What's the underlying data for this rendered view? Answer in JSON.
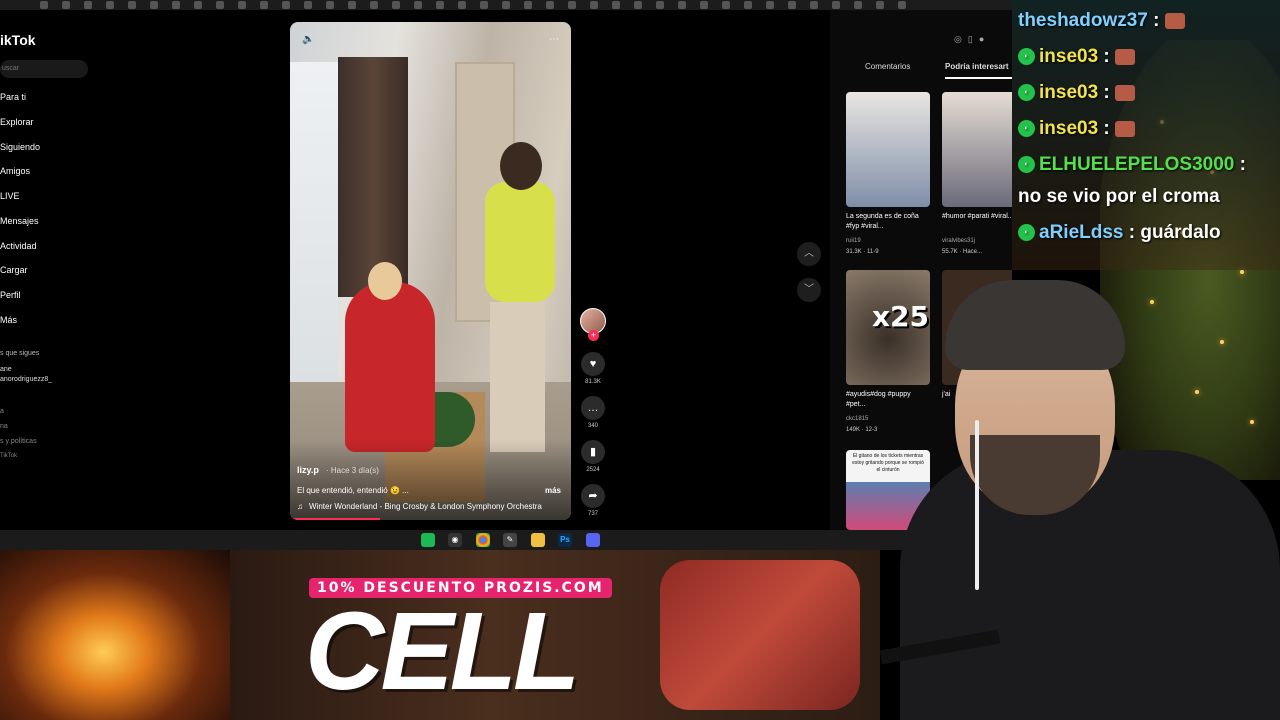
{
  "tiktok": {
    "logo": "ikTok",
    "search_placeholder": "uscar",
    "nav": [
      "Para ti",
      "Explorar",
      "Siguiendo",
      "Amigos",
      "LIVE",
      "Mensajes",
      "Actividad",
      "Cargar",
      "Perfil",
      "Más"
    ],
    "following_header": "s que sigues",
    "following_name": "ane",
    "following_handle": "anorodriguezz8_",
    "footer_links": [
      "a",
      "na",
      "s y políticas",
      "TikTok"
    ]
  },
  "video": {
    "author": "lizy.p",
    "posted": "· Hace 3 día(s)",
    "caption": "El que entendió, entendió 😉 ...",
    "more": "más",
    "music": "Winter Wonderland - Bing Crosby & London Symphony Orchestra",
    "progress_fraction": 0.32,
    "actions": {
      "likes": "81.3K",
      "comments": "340",
      "saves": "2524",
      "shares": "737"
    }
  },
  "right_panel": {
    "tabs": [
      "Comentarios",
      "Podría interesart"
    ],
    "active_tab": 1,
    "items": [
      {
        "caption": "La segunda es de coña #fyp #viral...",
        "user": "ruii19",
        "stats": "31.3K · 11-9"
      },
      {
        "caption": "#humor #parati #viral...",
        "user": "viralvibes31j",
        "stats": "55.7K · Hace..."
      },
      {
        "caption": "#ayudis#dog #puppy #pet...",
        "user": "ckc1815",
        "stats": "149K · 12-3",
        "overlay": "x25"
      },
      {
        "caption": "j'ai",
        "user": "",
        "stats": ""
      },
      {
        "caption": "El gitano de los tickets mientras estoy gritando porque se rompió el cinturón",
        "user": "",
        "stats": ""
      }
    ]
  },
  "chat": [
    {
      "user": "theshadowz37",
      "sep": " :",
      "msg": "",
      "color": "#7fd0ff",
      "badge": false,
      "emote": true
    },
    {
      "user": "inse03",
      "sep": " :",
      "msg": "",
      "color": "#f2e24f",
      "badge": true,
      "emote": true
    },
    {
      "user": "inse03",
      "sep": " :",
      "msg": "",
      "color": "#f2e24f",
      "badge": true,
      "emote": true
    },
    {
      "user": "inse03",
      "sep": " :",
      "msg": "",
      "color": "#f2e24f",
      "badge": true,
      "emote": true
    },
    {
      "user": "ELHUELEPELOS3000",
      "sep": " :",
      "msg": "",
      "color": "#54e04c",
      "badge": true,
      "emote": false
    },
    {
      "user": "",
      "sep": "",
      "msg": "no se vio por el croma",
      "color": "#ffffff",
      "badge": false,
      "emote": false
    },
    {
      "user": "aRieLdss",
      "sep": " :",
      "msg": " guárdalo",
      "color": "#7fd0ff",
      "badge": true,
      "emote": false
    }
  ],
  "overlay": {
    "promo": "10% DESCUENTO PROZIS.COM",
    "brand": "CELL"
  },
  "taskbar_icons": [
    "spotify-icon",
    "obs-icon",
    "chrome-icon",
    "editor-icon",
    "folder-icon",
    "photoshop-icon",
    "discord-icon"
  ],
  "colors": {
    "tiktok_red": "#fe2c55",
    "promo_pink": "#e6246e",
    "chat_green_badge": "#23c24a"
  }
}
